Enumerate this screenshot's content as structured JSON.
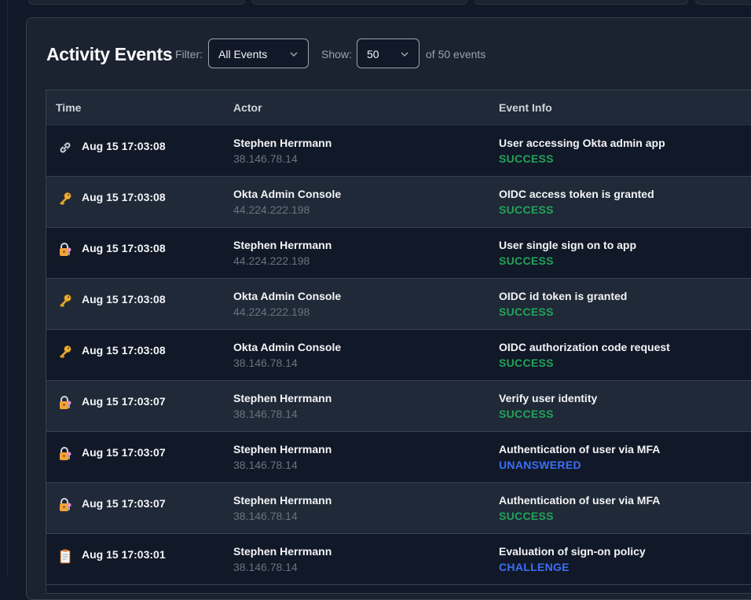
{
  "colors": {
    "success": "#22a35a",
    "unanswered": "#3b6ff5",
    "challenge": "#3b6ff5"
  },
  "header": {
    "title": "Activity Events",
    "filter_label": "Filter:",
    "filter_value": "All Events",
    "show_label": "Show:",
    "show_value": "50",
    "count_text": "of 50 events"
  },
  "table": {
    "columns": [
      "Time",
      "Actor",
      "Event Info"
    ],
    "rows": [
      {
        "icon": "link-icon",
        "time": "Aug 15 17:03:08",
        "actor": "Stephen Herrmann",
        "ip": "38.146.78.14",
        "event": "User accessing Okta admin app",
        "status": "SUCCESS"
      },
      {
        "icon": "key-icon",
        "time": "Aug 15 17:03:08",
        "actor": "Okta Admin Console",
        "ip": "44.224.222.198",
        "event": "OIDC access token is granted",
        "status": "SUCCESS"
      },
      {
        "icon": "lock-icon",
        "time": "Aug 15 17:03:08",
        "actor": "Stephen Herrmann",
        "ip": "44.224.222.198",
        "event": "User single sign on to app",
        "status": "SUCCESS"
      },
      {
        "icon": "key-icon",
        "time": "Aug 15 17:03:08",
        "actor": "Okta Admin Console",
        "ip": "44.224.222.198",
        "event": "OIDC id token is granted",
        "status": "SUCCESS"
      },
      {
        "icon": "key-icon",
        "time": "Aug 15 17:03:08",
        "actor": "Okta Admin Console",
        "ip": "38.146.78.14",
        "event": "OIDC authorization code request",
        "status": "SUCCESS"
      },
      {
        "icon": "lock-icon",
        "time": "Aug 15 17:03:07",
        "actor": "Stephen Herrmann",
        "ip": "38.146.78.14",
        "event": "Verify user identity",
        "status": "SUCCESS"
      },
      {
        "icon": "lock-icon",
        "time": "Aug 15 17:03:07",
        "actor": "Stephen Herrmann",
        "ip": "38.146.78.14",
        "event": "Authentication of user via MFA",
        "status": "UNANSWERED"
      },
      {
        "icon": "lock-icon",
        "time": "Aug 15 17:03:07",
        "actor": "Stephen Herrmann",
        "ip": "38.146.78.14",
        "event": "Authentication of user via MFA",
        "status": "SUCCESS"
      },
      {
        "icon": "clipboard-icon",
        "time": "Aug 15 17:03:01",
        "actor": "Stephen Herrmann",
        "ip": "38.146.78.14",
        "event": "Evaluation of sign-on policy",
        "status": "CHALLENGE"
      }
    ]
  }
}
